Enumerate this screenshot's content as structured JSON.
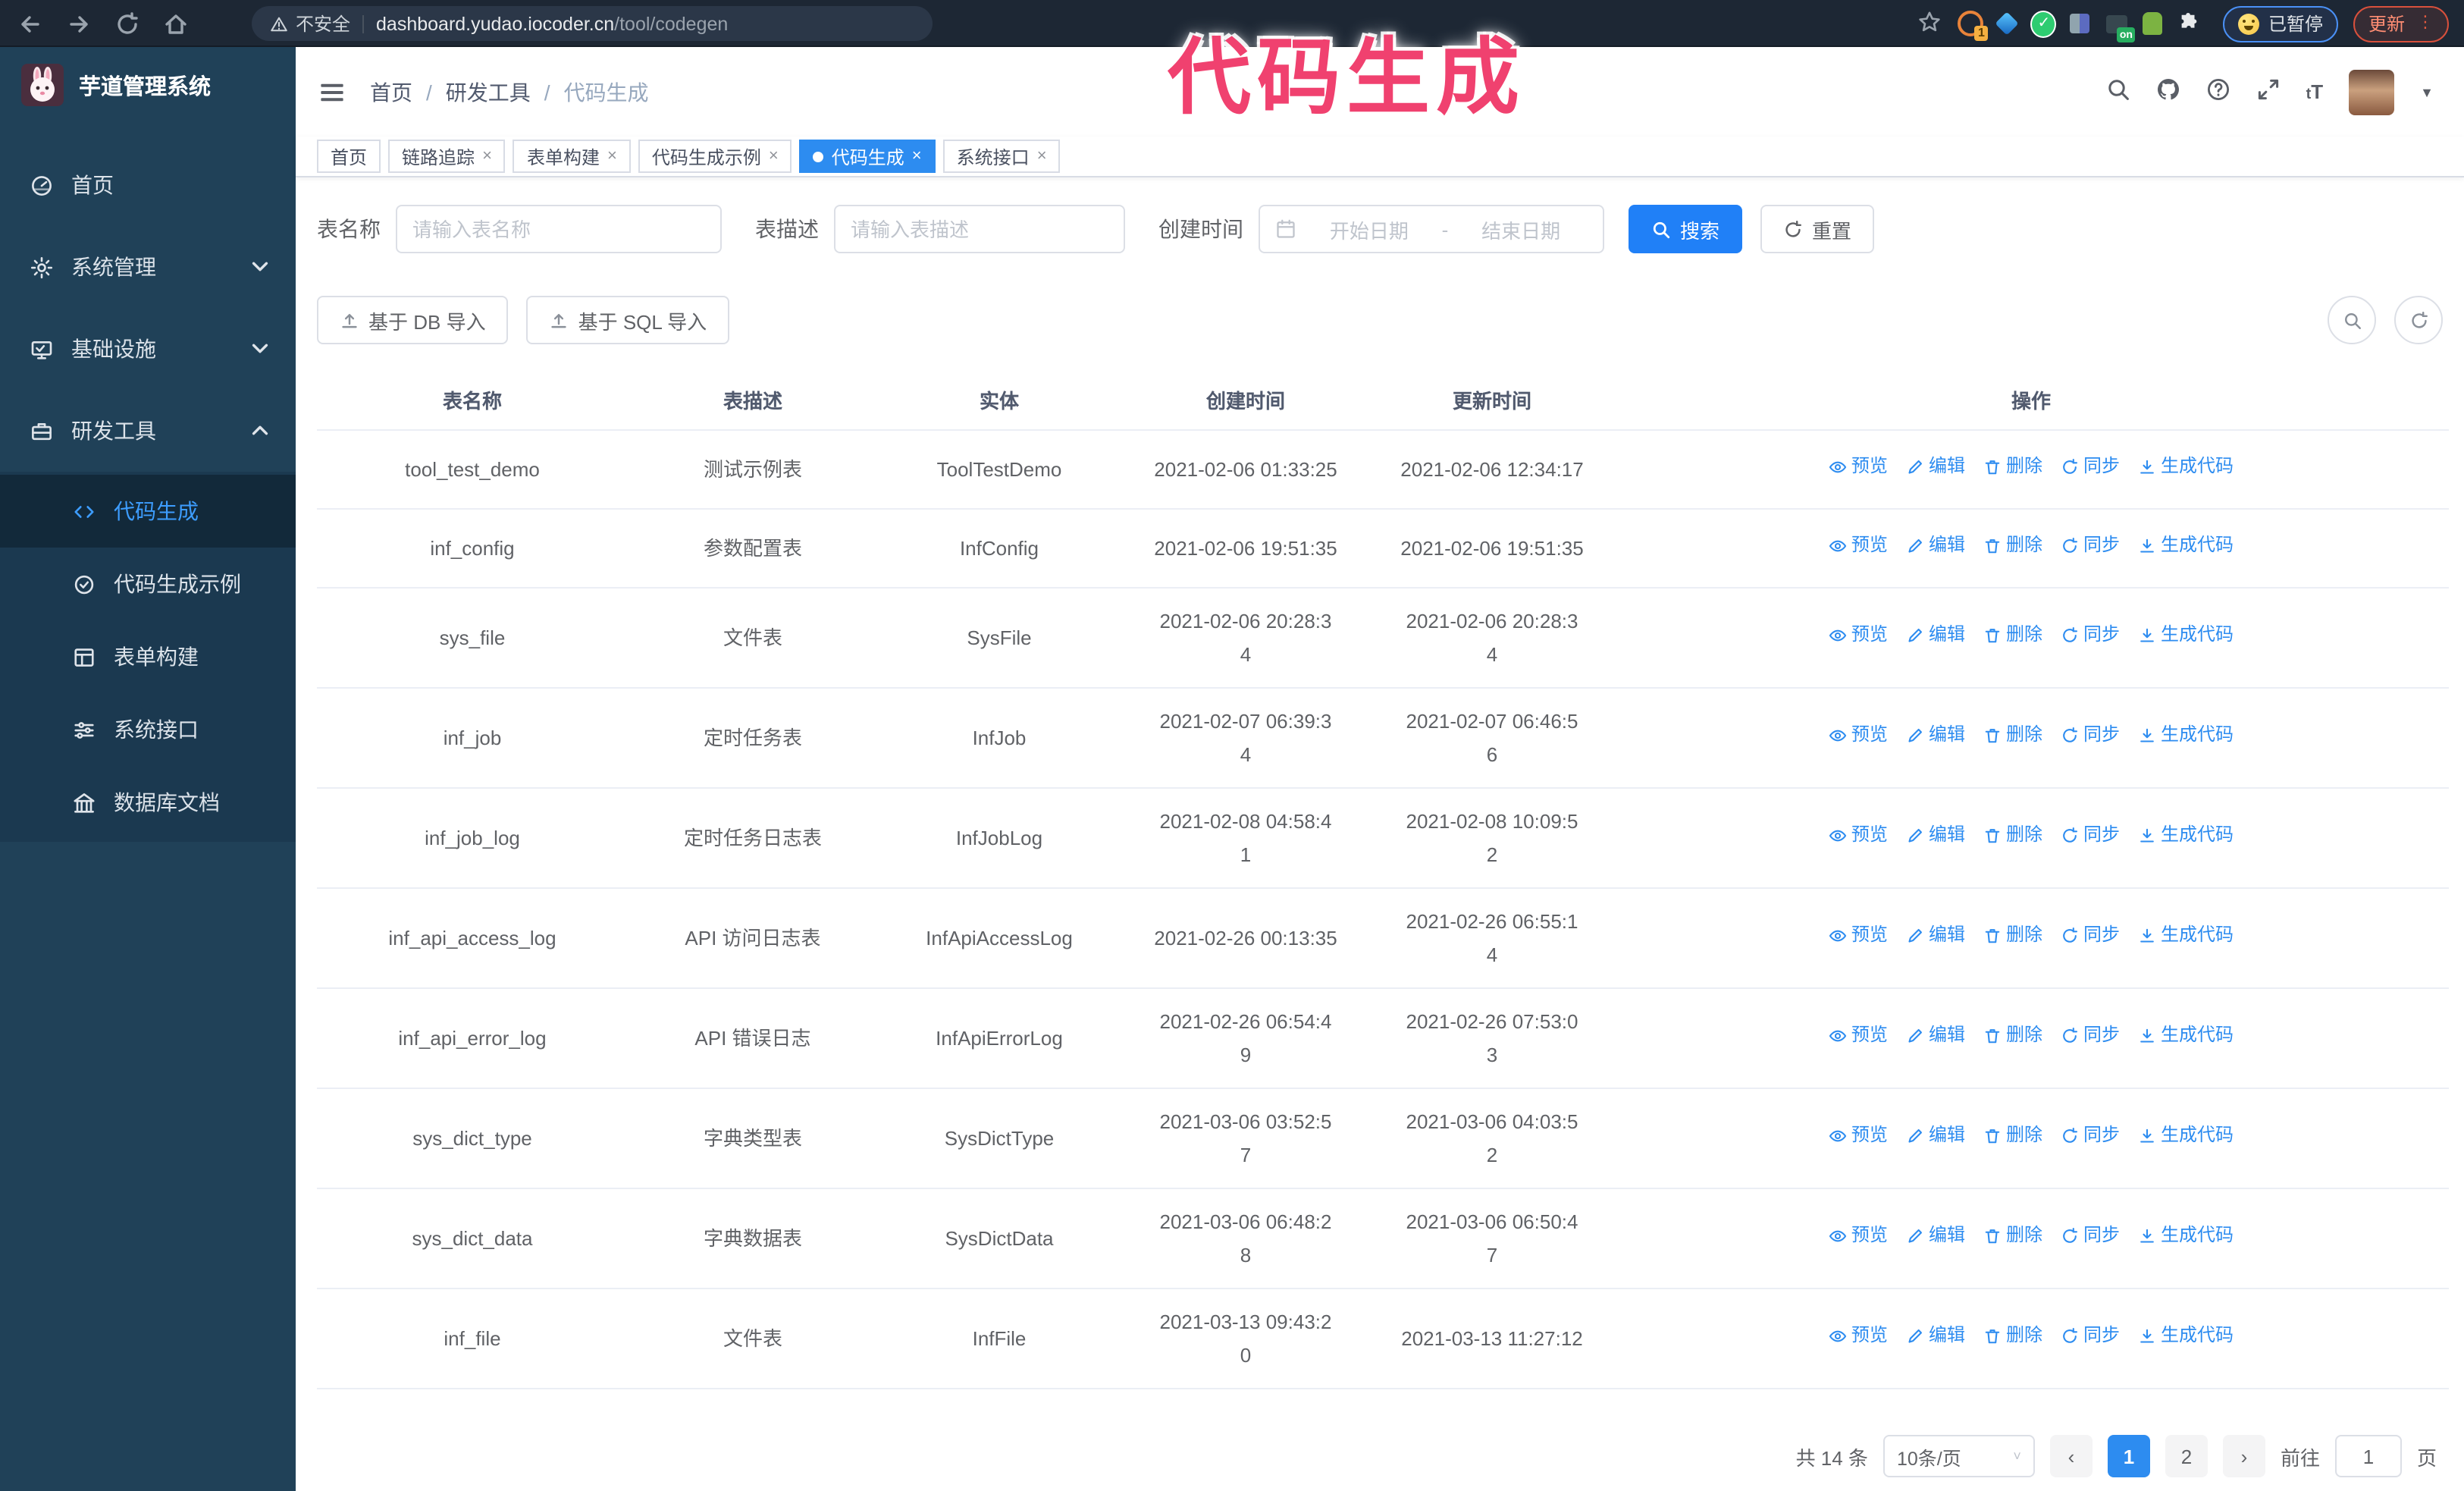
{
  "browser": {
    "security_label": "不安全",
    "url_domain": "dashboard.yudao.iocoder.cn",
    "url_path": "/tool/codegen",
    "extension_badge": "1",
    "extension_on_badge": "on",
    "paused_badge": "已暂停",
    "update_button": "更新"
  },
  "annotation": {
    "text": "代码生成",
    "color": "#f0416f"
  },
  "sidebar": {
    "app_title": "芋道管理系统",
    "items": [
      {
        "label": "首页",
        "icon": "dashboard-icon"
      },
      {
        "label": "系统管理",
        "icon": "gear-icon",
        "chevron": "down"
      },
      {
        "label": "基础设施",
        "icon": "monitor-icon",
        "chevron": "down"
      },
      {
        "label": "研发工具",
        "icon": "toolbox-icon",
        "chevron": "up",
        "expanded": true
      }
    ],
    "sub_items": [
      {
        "label": "代码生成",
        "icon": "code-icon",
        "active": true
      },
      {
        "label": "代码生成示例",
        "icon": "badge-check-icon",
        "active": false
      },
      {
        "label": "表单构建",
        "icon": "form-icon",
        "active": false
      },
      {
        "label": "系统接口",
        "icon": "sliders-icon",
        "active": false
      },
      {
        "label": "数据库文档",
        "icon": "columns-icon",
        "active": false
      }
    ]
  },
  "navbar": {
    "breadcrumb": [
      "首页",
      "研发工具",
      "代码生成"
    ]
  },
  "tags": [
    {
      "label": "首页",
      "closable": false,
      "active": false
    },
    {
      "label": "链路追踪",
      "closable": true,
      "active": false
    },
    {
      "label": "表单构建",
      "closable": true,
      "active": false
    },
    {
      "label": "代码生成示例",
      "closable": true,
      "active": false
    },
    {
      "label": "代码生成",
      "closable": true,
      "active": true
    },
    {
      "label": "系统接口",
      "closable": true,
      "active": false
    }
  ],
  "search_form": {
    "table_name_label": "表名称",
    "table_name_placeholder": "请输入表名称",
    "table_desc_label": "表描述",
    "table_desc_placeholder": "请输入表描述",
    "create_time_label": "创建时间",
    "start_placeholder": "开始日期",
    "range_separator": "-",
    "end_placeholder": "结束日期",
    "search_button": "搜索",
    "reset_button": "重置"
  },
  "toolbar_buttons": {
    "import_db": "基于 DB 导入",
    "import_sql": "基于 SQL 导入"
  },
  "table": {
    "columns": [
      "表名称",
      "表描述",
      "实体",
      "创建时间",
      "更新时间",
      "操作"
    ],
    "actions": [
      {
        "label": "预览",
        "icon": "eye"
      },
      {
        "label": "编辑",
        "icon": "edit"
      },
      {
        "label": "删除",
        "icon": "delete"
      },
      {
        "label": "同步",
        "icon": "sync"
      },
      {
        "label": "生成代码",
        "icon": "download"
      }
    ],
    "rows": [
      {
        "name": "tool_test_demo",
        "desc": "测试示例表",
        "entity": "ToolTestDemo",
        "created": "2021-02-06 01:33:25",
        "created_wrap": false,
        "updated": "2021-02-06 12:34:17",
        "updated_wrap": false
      },
      {
        "name": "inf_config",
        "desc": "参数配置表",
        "entity": "InfConfig",
        "created": "2021-02-06 19:51:35",
        "created_wrap": false,
        "updated": "2021-02-06 19:51:35",
        "updated_wrap": false
      },
      {
        "name": "sys_file",
        "desc": "文件表",
        "entity": "SysFile",
        "created": "2021-02-06 20:28:34",
        "created_wrap": true,
        "updated": "2021-02-06 20:28:34",
        "updated_wrap": true
      },
      {
        "name": "inf_job",
        "desc": "定时任务表",
        "entity": "InfJob",
        "created": "2021-02-07 06:39:34",
        "created_wrap": true,
        "updated": "2021-02-07 06:46:56",
        "updated_wrap": true
      },
      {
        "name": "inf_job_log",
        "desc": "定时任务日志表",
        "entity": "InfJobLog",
        "created": "2021-02-08 04:58:41",
        "created_wrap": true,
        "updated": "2021-02-08 10:09:52",
        "updated_wrap": true
      },
      {
        "name": "inf_api_access_log",
        "desc": "API 访问日志表",
        "entity": "InfApiAccessLog",
        "created": "2021-02-26 00:13:35",
        "created_wrap": false,
        "updated": "2021-02-26 06:55:14",
        "updated_wrap": true
      },
      {
        "name": "inf_api_error_log",
        "desc": "API 错误日志",
        "entity": "InfApiErrorLog",
        "created": "2021-02-26 06:54:49",
        "created_wrap": true,
        "updated": "2021-02-26 07:53:03",
        "updated_wrap": true
      },
      {
        "name": "sys_dict_type",
        "desc": "字典类型表",
        "entity": "SysDictType",
        "created": "2021-03-06 03:52:57",
        "created_wrap": true,
        "updated": "2021-03-06 04:03:52",
        "updated_wrap": true
      },
      {
        "name": "sys_dict_data",
        "desc": "字典数据表",
        "entity": "SysDictData",
        "created": "2021-03-06 06:48:28",
        "created_wrap": true,
        "updated": "2021-03-06 06:50:47",
        "updated_wrap": true
      },
      {
        "name": "inf_file",
        "desc": "文件表",
        "entity": "InfFile",
        "created": "2021-03-13 09:43:20",
        "created_wrap": true,
        "updated": "2021-03-13 11:27:12",
        "updated_wrap": false
      }
    ]
  },
  "pagination": {
    "total": "共 14 条",
    "page_size": "10条/页",
    "pages": [
      "1",
      "2"
    ],
    "active_page": "1",
    "goto_label": "前往",
    "goto_value": "1",
    "page_suffix": "页"
  },
  "theme": {
    "primary": "#2d8cf0",
    "search_button_blue": "#2080f7",
    "sidebar_bg": "#204158",
    "submenu_bg": "#1b3950",
    "active_link": "#3d9dff",
    "browser_bar_bg": "#1d2734",
    "annotation_pink": "#f0416f",
    "update_button_red": "#d8503c",
    "paused_badge_blue": "#4a90f5"
  }
}
